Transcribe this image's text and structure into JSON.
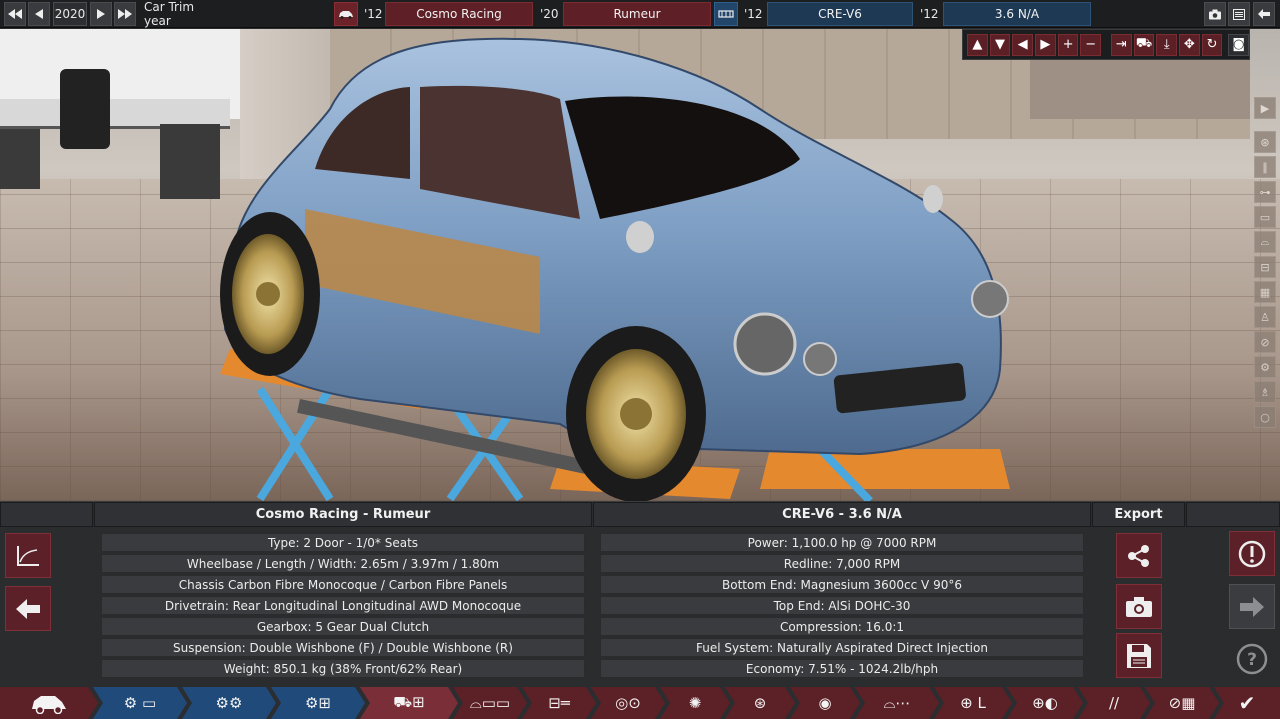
{
  "topbar": {
    "year": "2020",
    "trim_year_label": "Car Trim year",
    "model_year": "'12",
    "brand": "Cosmo Racing",
    "trim_year": "'20",
    "model": "Rumeur",
    "engine_family_year": "'12",
    "engine_family": "CRE-V6",
    "engine_variant_year": "'12",
    "engine_variant": "3.6 N/A"
  },
  "info": {
    "car_heading": "Cosmo Racing - Rumeur",
    "engine_heading": "CRE-V6 - 3.6 N/A",
    "export_heading": "Export",
    "car_specs": [
      "Type: 2 Door - 1/0* Seats",
      "Wheelbase / Length / Width: 2.65m / 3.97m / 1.80m",
      "Chassis Carbon Fibre Monocoque / Carbon Fibre Panels",
      "Drivetrain: Rear Longitudinal Longitudinal AWD Monocoque",
      "Gearbox: 5 Gear Dual Clutch",
      "Suspension: Double Wishbone (F) / Double Wishbone (R)",
      "Weight: 850.1 kg (38% Front/62% Rear)"
    ],
    "engine_specs": [
      "Power: 1,100.0 hp @ 7000 RPM",
      "Redline:  7,000 RPM",
      "Bottom End: Magnesium 3600cc V 90°6",
      "Top End: AlSi DOHC-30",
      "Compression: 16.0:1",
      "Fuel System: Naturally Aspirated Direct Injection",
      "Economy: 7.51% - 1024.2lb/hph"
    ]
  },
  "icons": {
    "prev_prev": "⏮",
    "prev": "◀",
    "next": "▶",
    "next_next": "⏭",
    "car_icon": "car-icon",
    "engine_icon": "engine-icon"
  },
  "colors": {
    "accent_red": "#5c2027",
    "accent_blue": "#1f4a7a",
    "panel_bg": "#2b2c2e"
  }
}
